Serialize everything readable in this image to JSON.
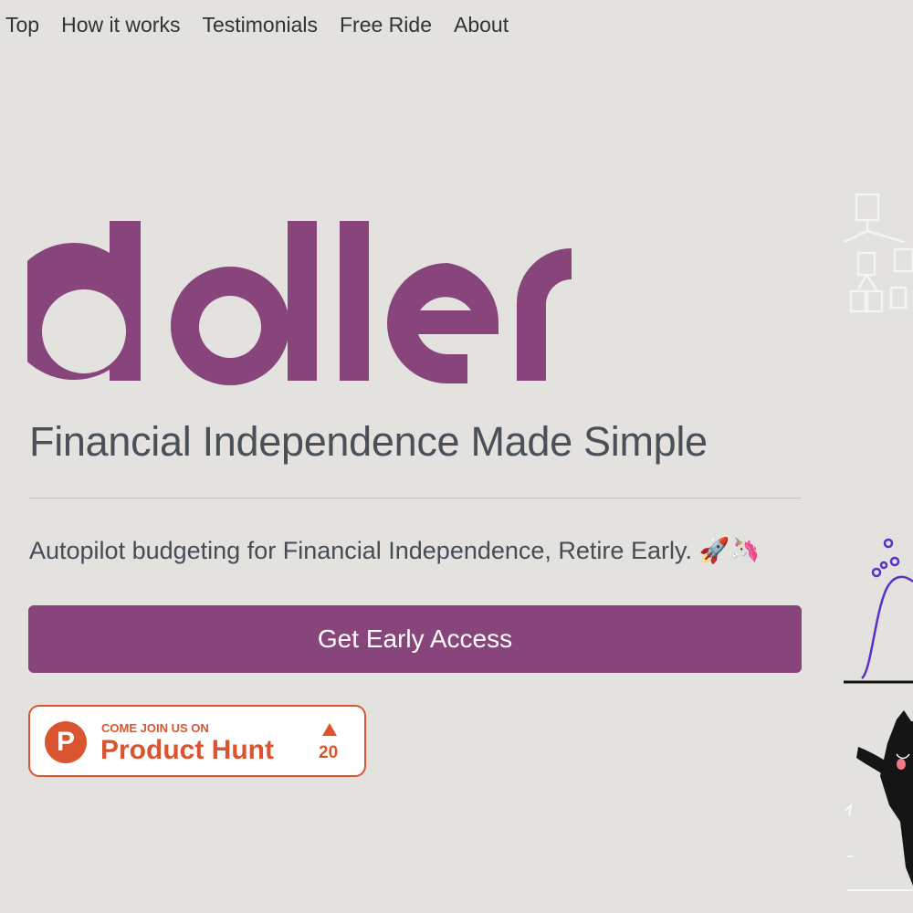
{
  "nav": {
    "items": [
      "Top",
      "How it works",
      "Testimonials",
      "Free Ride",
      "About"
    ]
  },
  "logo": {
    "text": "doller",
    "color": "#88457b"
  },
  "hero": {
    "tagline": "Financial Independence Made Simple",
    "subtitle": "Autopilot budgeting for Financial Independence, Retire Early. 🚀🦄",
    "cta_label": "Get Early Access"
  },
  "product_hunt": {
    "small_text": "COME JOIN US ON",
    "big_text": "Product Hunt",
    "logo_letter": "P",
    "upvotes": "20",
    "color": "#da552f"
  },
  "colors": {
    "background": "#e3e2df",
    "brand": "#88457b",
    "text": "#495057"
  }
}
